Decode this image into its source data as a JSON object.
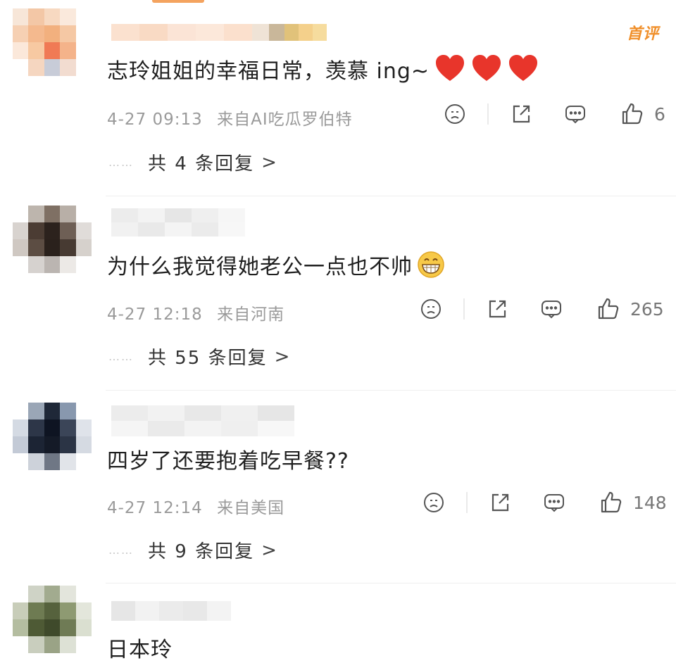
{
  "comments": [
    {
      "text": "志玲姐姐的幸福日常，羡慕 ing~",
      "emoji": "heart-emoji",
      "emoji_count": 3,
      "date": "4-27",
      "time": "09:13",
      "source": "来自AI吃瓜罗伯特",
      "like_count": "6",
      "reply_text": "共 4 条回复",
      "badge": "首评"
    },
    {
      "text": "为什么我觉得她老公一点也不帅",
      "emoji": "grin-emoji",
      "date": "4-27",
      "time": "12:18",
      "source": "来自河南",
      "like_count": "265",
      "reply_text": "共 55 条回复"
    },
    {
      "text": "四岁了还要抱着吃早餐??",
      "date": "4-27",
      "time": "12:14",
      "source": "来自美国",
      "like_count": "148",
      "reply_text": "共 9 条回复"
    },
    {
      "text": "日本玲"
    }
  ],
  "ui": {
    "reply_dots": "……",
    "reply_chevron": ">",
    "accent": "#f08f2a",
    "meta_color": "#9a9a9a"
  }
}
